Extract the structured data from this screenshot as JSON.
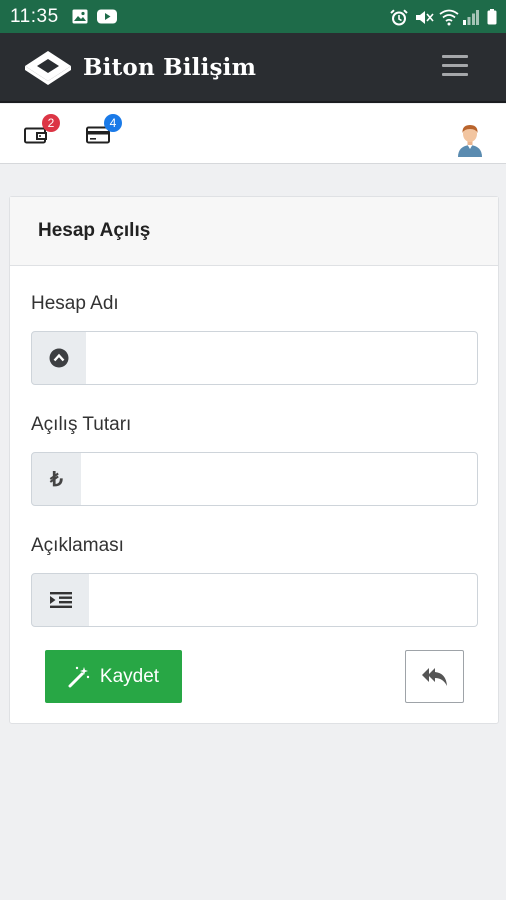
{
  "status_bar": {
    "time": "11:35"
  },
  "app": {
    "brand": "Biton Bilişim"
  },
  "topbar": {
    "wallet_badge": "2",
    "card_badge": "4"
  },
  "form": {
    "title": "Hesap Açılış",
    "fields": [
      {
        "label": "Hesap Adı",
        "value": "",
        "icon": "circle-chevron-up-icon"
      },
      {
        "label": "Açılış Tutarı",
        "value": "",
        "icon": "lira-icon"
      },
      {
        "label": "Açıklaması",
        "value": "",
        "icon": "indent-icon"
      }
    ],
    "lira_symbol": "₺",
    "save_label": "Kaydet",
    "back_icon": "reply-all-icon"
  },
  "colors": {
    "status_bar": "#1e6b49",
    "navbar": "#2a2d31",
    "save_button": "#28a745",
    "badge_red": "#dc3545",
    "badge_blue": "#1a7ae8"
  }
}
